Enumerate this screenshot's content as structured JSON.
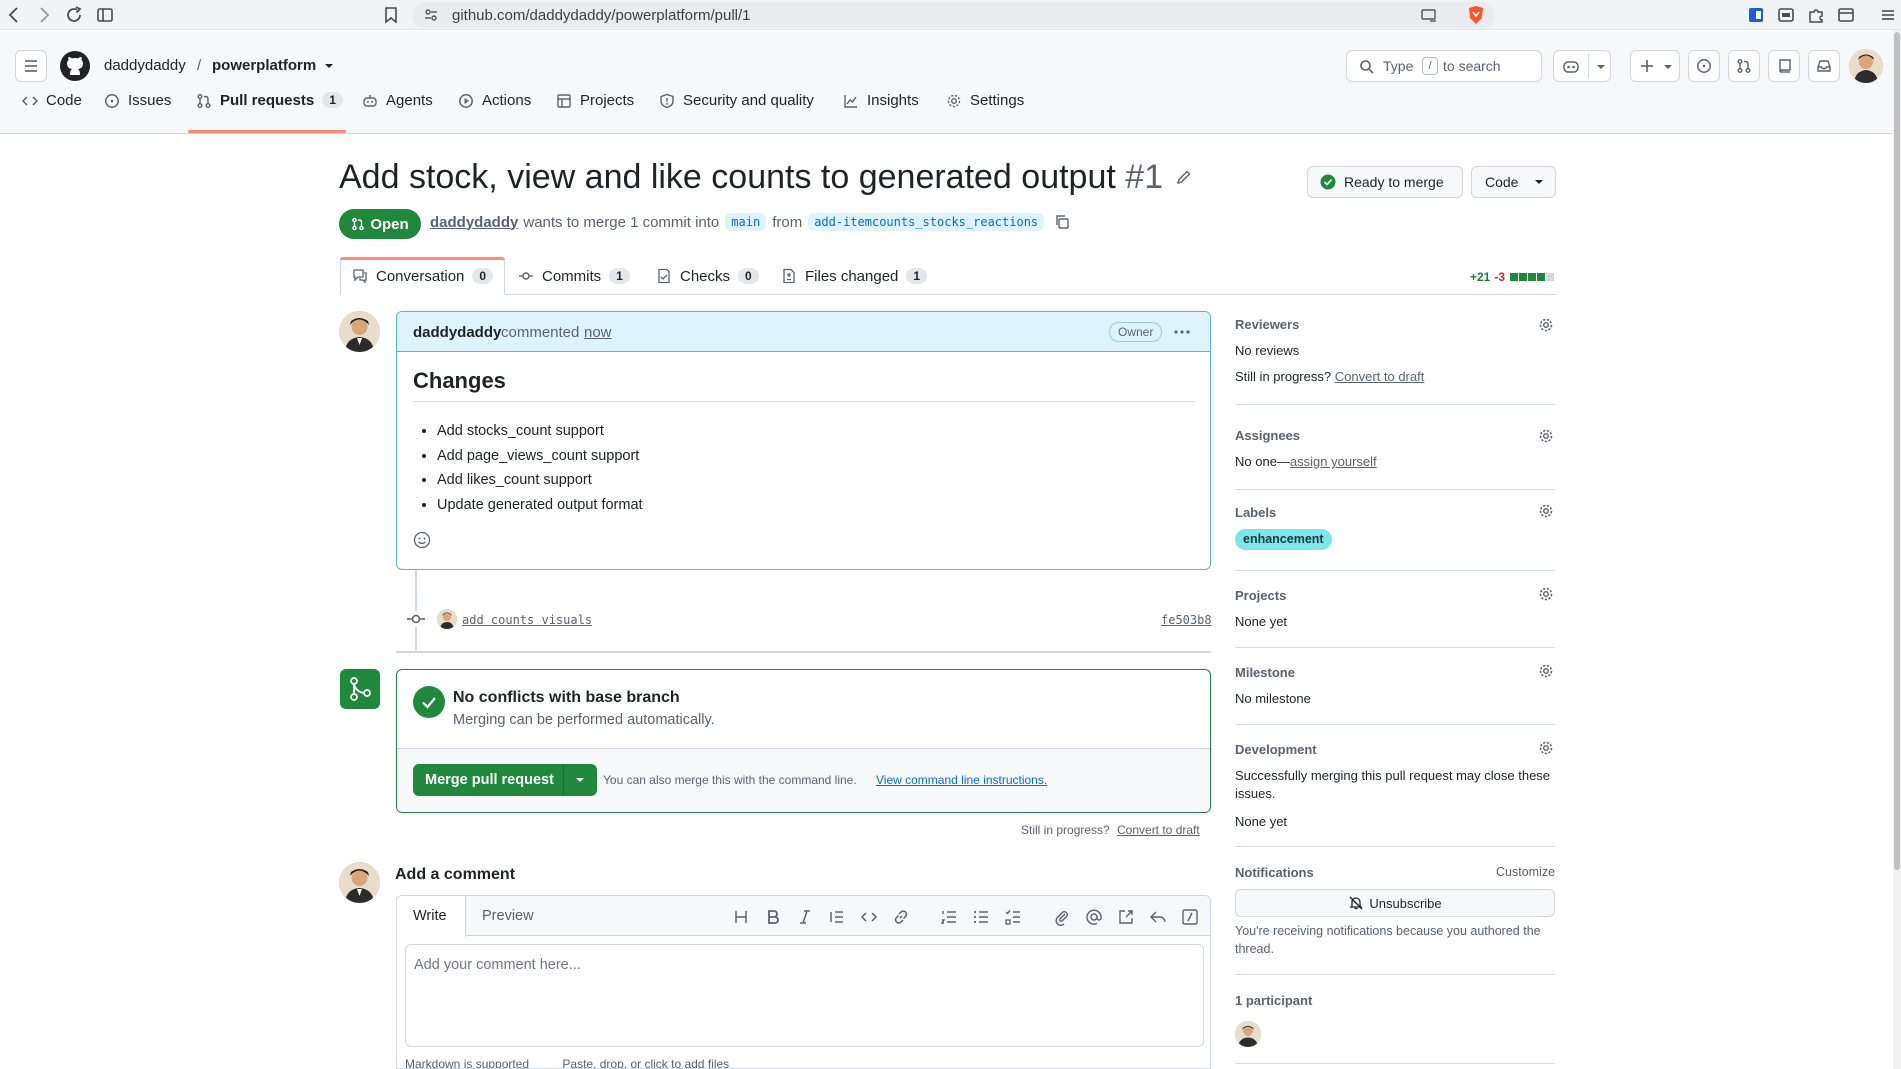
{
  "browser": {
    "url": "github.com/daddydaddy/powerplatform/pull/1"
  },
  "header": {
    "owner": "daddydaddy",
    "slash": "/",
    "repo": "powerplatform",
    "search_placeholder_pre": "Type",
    "search_key": "/",
    "search_placeholder_post": "to search"
  },
  "nav": [
    {
      "label": "Code"
    },
    {
      "label": "Issues"
    },
    {
      "label": "Pull requests",
      "count": "1"
    },
    {
      "label": "Agents"
    },
    {
      "label": "Actions"
    },
    {
      "label": "Projects"
    },
    {
      "label": "Security and quality"
    },
    {
      "label": "Insights"
    },
    {
      "label": "Settings"
    }
  ],
  "pr": {
    "title": "Add stock, view and like counts to generated output",
    "number": "#1",
    "state": "Open",
    "author": "daddydaddy",
    "merge_text": "wants to merge 1 commit into",
    "base": "main",
    "from": "from",
    "head": "add-itemcounts_stocks_reactions",
    "ready_button": "Ready to merge",
    "code_button": "Code",
    "additions": "+21",
    "deletions": "-3"
  },
  "tabs": [
    {
      "label": "Conversation",
      "count": "0"
    },
    {
      "label": "Commits",
      "count": "1"
    },
    {
      "label": "Checks",
      "count": "0"
    },
    {
      "label": "Files changed",
      "count": "1"
    }
  ],
  "comment": {
    "author": "daddydaddy",
    "action": "commented",
    "time": "now",
    "role": "Owner",
    "heading": "Changes",
    "items": [
      "Add stocks_count support",
      "Add page_views_count support",
      "Add likes_count support",
      "Update generated output format"
    ]
  },
  "commit": {
    "message": "add counts visuals",
    "sha": "fe503b8"
  },
  "merge": {
    "title": "No conflicts with base branch",
    "subtitle": "Merging can be performed automatically.",
    "button": "Merge pull request",
    "alt_text": "You can also merge this with the command line.",
    "alt_link": "View command line instructions.",
    "draft_q": "Still in progress?",
    "draft_link": "Convert to draft"
  },
  "add_comment": {
    "heading": "Add a comment",
    "tab_write": "Write",
    "tab_preview": "Preview",
    "placeholder": "Add your comment here...",
    "footer_md": "Markdown is supported",
    "footer_files": "Paste, drop, or click to add files"
  },
  "sidebar": {
    "reviewers_title": "Reviewers",
    "reviewers_value": "No reviews",
    "reviewers_q": "Still in progress?",
    "reviewers_link": "Convert to draft",
    "assignees_title": "Assignees",
    "assignees_value": "No one—",
    "assignees_link": "assign yourself",
    "labels_title": "Labels",
    "label": "enhancement",
    "projects_title": "Projects",
    "projects_value": "None yet",
    "milestone_title": "Milestone",
    "milestone_value": "No milestone",
    "development_title": "Development",
    "development_text": "Successfully merging this pull request may close these issues.",
    "development_value": "None yet",
    "notifications_title": "Notifications",
    "notifications_customize": "Customize",
    "unsubscribe": "Unsubscribe",
    "notifications_reason": "You're receiving notifications because you authored the thread.",
    "participants": "1 participant"
  },
  "colors": {
    "green": "#1f883d",
    "blue": "#0969da",
    "label_bg": "#7ee5e8"
  }
}
